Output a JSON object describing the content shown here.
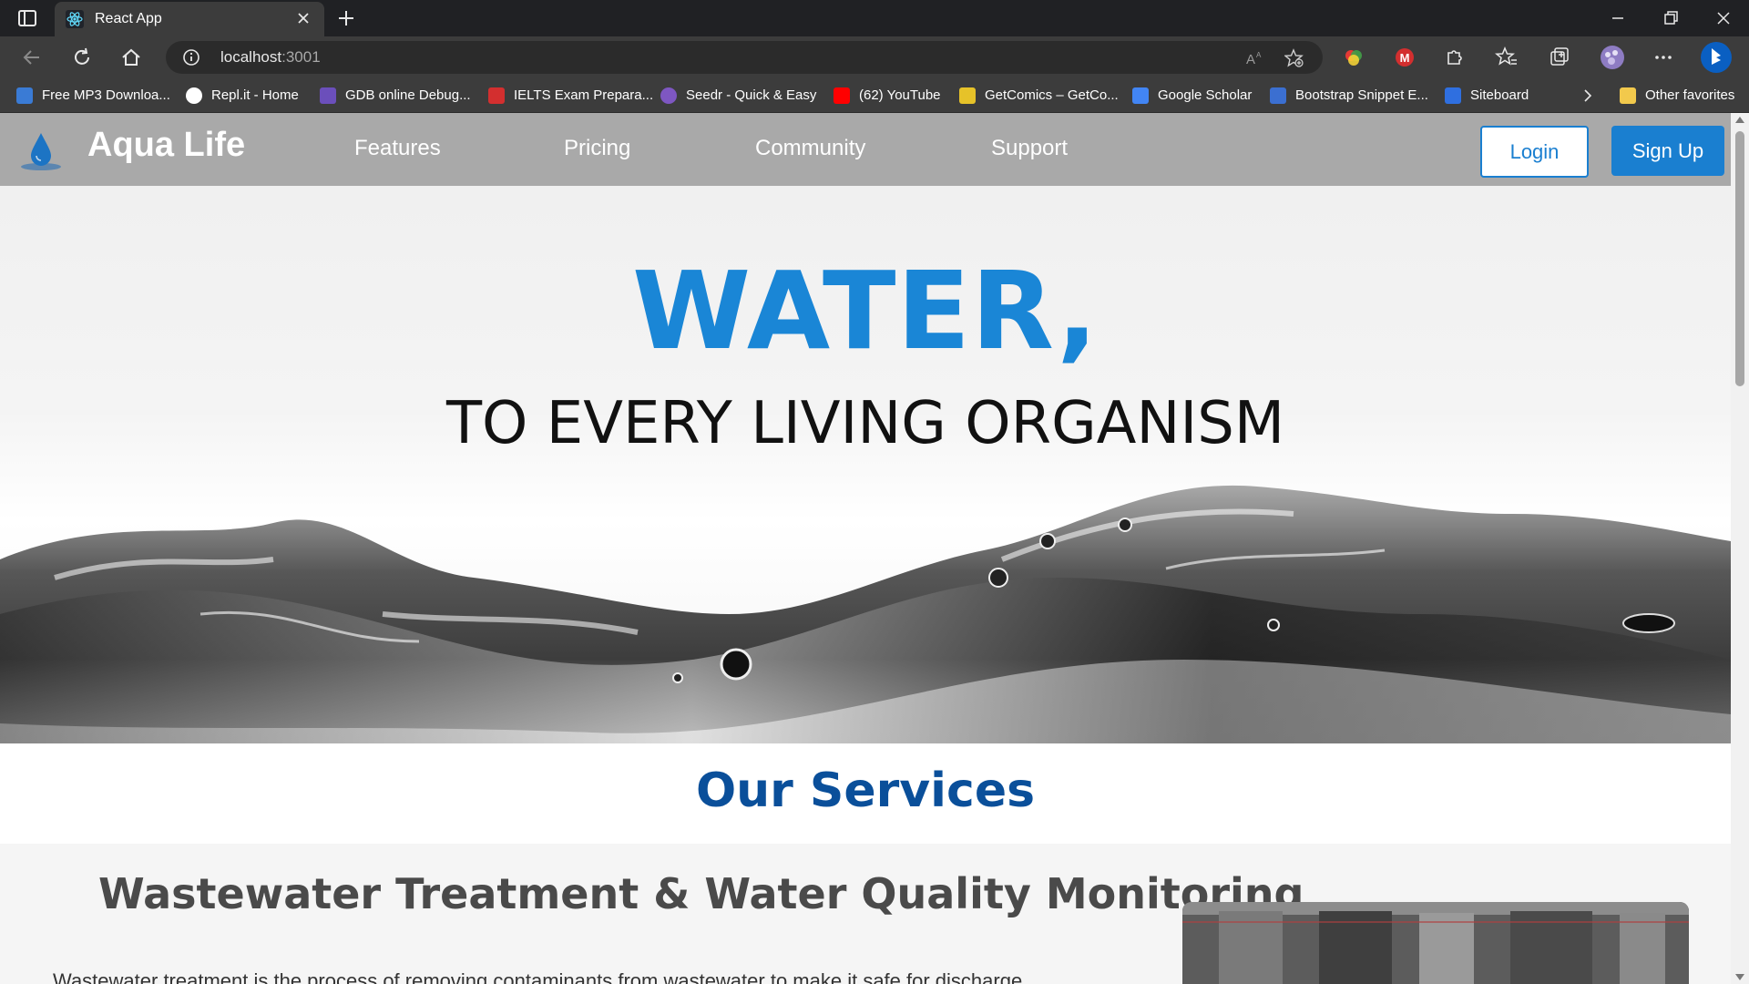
{
  "browser": {
    "tab_title": "React App",
    "url_host": "localhost",
    "url_port": ":3001",
    "bookmarks": [
      {
        "label": "Free MP3 Downloa...",
        "icon": "music-icon",
        "color": "#3a7bd5"
      },
      {
        "label": "Repl.it - Home",
        "icon": "replit-icon",
        "color": "#ffffff"
      },
      {
        "label": "GDB online Debug...",
        "icon": "bolt-icon",
        "color": "#6b4fbb"
      },
      {
        "label": "IELTS Exam Prepara...",
        "icon": "ielts-icon",
        "color": "#d32f2f"
      },
      {
        "label": "Seedr - Quick & Easy",
        "icon": "seedr-icon",
        "color": "#7e57c2"
      },
      {
        "label": "(62) YouTube",
        "icon": "youtube-icon",
        "color": "#ff0000"
      },
      {
        "label": "GetComics – GetCo...",
        "icon": "comics-icon",
        "color": "#e6c229"
      },
      {
        "label": "Google Scholar",
        "icon": "scholar-icon",
        "color": "#4285f4"
      },
      {
        "label": "Bootstrap Snippet E...",
        "icon": "bootstrap-icon",
        "color": "#3b6fd1"
      },
      {
        "label": "Siteboard",
        "icon": "siteboard-icon",
        "color": "#2f6fe0"
      }
    ],
    "other_favorites": "Other favorites"
  },
  "site": {
    "brand": "Aqua Life",
    "nav": [
      "Features",
      "Pricing",
      "Community",
      "Support"
    ],
    "login": "Login",
    "signup": "Sign Up",
    "accent_color": "#1a86d6"
  },
  "hero": {
    "title": "WATER,",
    "subtitle": "TO EVERY LIVING ORGANISM"
  },
  "services": {
    "heading": "Our Services",
    "item_title": "Wastewater Treatment & Water Quality Monitoring",
    "item_text": "Wastewater treatment is the process of removing contaminants from wastewater to make it safe for discharge"
  }
}
